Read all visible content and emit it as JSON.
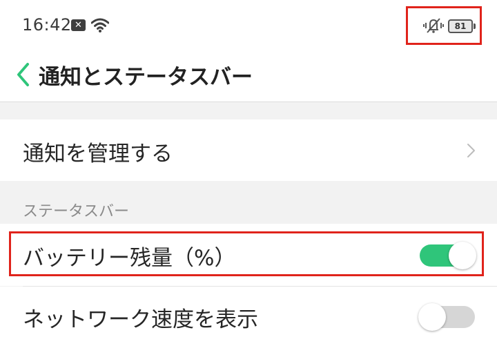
{
  "status_bar": {
    "time": "16:42",
    "notification_icon": "notification-badge-icon",
    "wifi_icon": "wifi-icon",
    "mute_icon": "vibrate-mute-icon",
    "battery_level": "81"
  },
  "header": {
    "back_icon": "back-chevron-icon",
    "title": "通知とステータスバー"
  },
  "manage_notifications": {
    "label": "通知を管理する",
    "icon": "chevron-right-icon"
  },
  "status_bar_section": {
    "header": "ステータスバー",
    "items": [
      {
        "label": "バッテリー残量（%）",
        "enabled": true
      },
      {
        "label": "ネットワーク速度を表示",
        "enabled": false
      }
    ]
  },
  "colors": {
    "accent": "#2fc57a",
    "highlight": "#e0231b",
    "toggle_off": "#d6d6d6"
  }
}
